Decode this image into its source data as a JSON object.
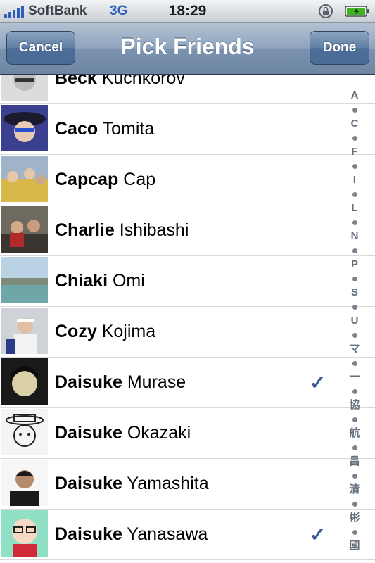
{
  "status_bar": {
    "carrier": "SoftBank",
    "network": "3G",
    "time": "18:29",
    "icons": [
      "signal-bars-icon",
      "rotation-lock-icon",
      "battery-charging-icon"
    ],
    "colors": {
      "network": "#2b5fb8",
      "battery": "#3cb521"
    }
  },
  "nav": {
    "title": "Pick Friends",
    "cancel_label": "Cancel",
    "done_label": "Done"
  },
  "friends": [
    {
      "first": "Beck",
      "last": "Kuchkorov",
      "selected": false
    },
    {
      "first": "Caco",
      "last": "Tomita",
      "selected": false
    },
    {
      "first": "Capcap",
      "last": "Cap",
      "selected": false
    },
    {
      "first": "Charlie",
      "last": "Ishibashi",
      "selected": false
    },
    {
      "first": "Chiaki",
      "last": "Omi",
      "selected": false
    },
    {
      "first": "Cozy",
      "last": "Kojima",
      "selected": false
    },
    {
      "first": "Daisuke",
      "last": "Murase",
      "selected": true
    },
    {
      "first": "Daisuke",
      "last": "Okazaki",
      "selected": false
    },
    {
      "first": "Daisuke",
      "last": "Yamashita",
      "selected": false
    },
    {
      "first": "Daisuke",
      "last": "Yanasawa",
      "selected": true
    }
  ],
  "check_mark": "✓",
  "index_letters": [
    "A",
    "C",
    "F",
    "I",
    "L",
    "N",
    "P",
    "S",
    "U",
    "マ",
    "一",
    "協",
    "航",
    "昌",
    "清",
    "彬",
    "國"
  ]
}
